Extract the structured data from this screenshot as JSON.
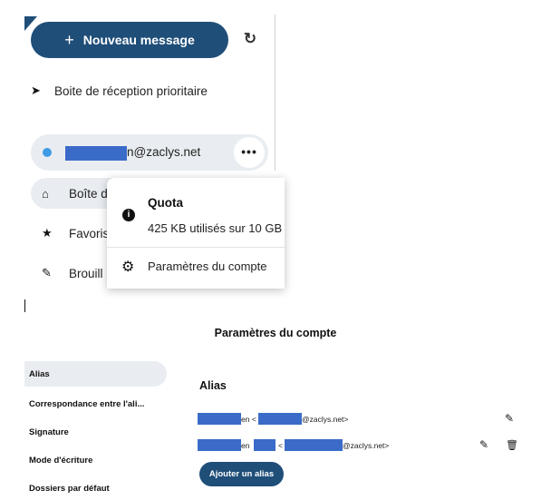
{
  "sidebar": {
    "new_message": "Nouveau message",
    "priority_inbox": "Boite de réception prioritaire",
    "account_suffix": "n@zaclys.net",
    "inbox": "Boîte d",
    "favorites": "Favoris",
    "drafts": "Brouill"
  },
  "popup": {
    "quota_title": "Quota",
    "quota_text": "425 KB utilisés sur 10 GB",
    "settings": "Paramètres du compte"
  },
  "settings_panel": {
    "title": "Paramètres du compte",
    "nav": [
      "Alias",
      "Correspondance entre l'ali...",
      "Signature",
      "Mode d'écriture",
      "Dossiers par défaut"
    ],
    "alias_heading": "Alias",
    "alias_rows": [
      {
        "part1": "en <",
        "part2": "@zaclys.net>"
      },
      {
        "part1": "en",
        "part2": "<",
        "part3": "@zaclys.net>"
      }
    ],
    "add_alias": "Ajouter un alias"
  }
}
